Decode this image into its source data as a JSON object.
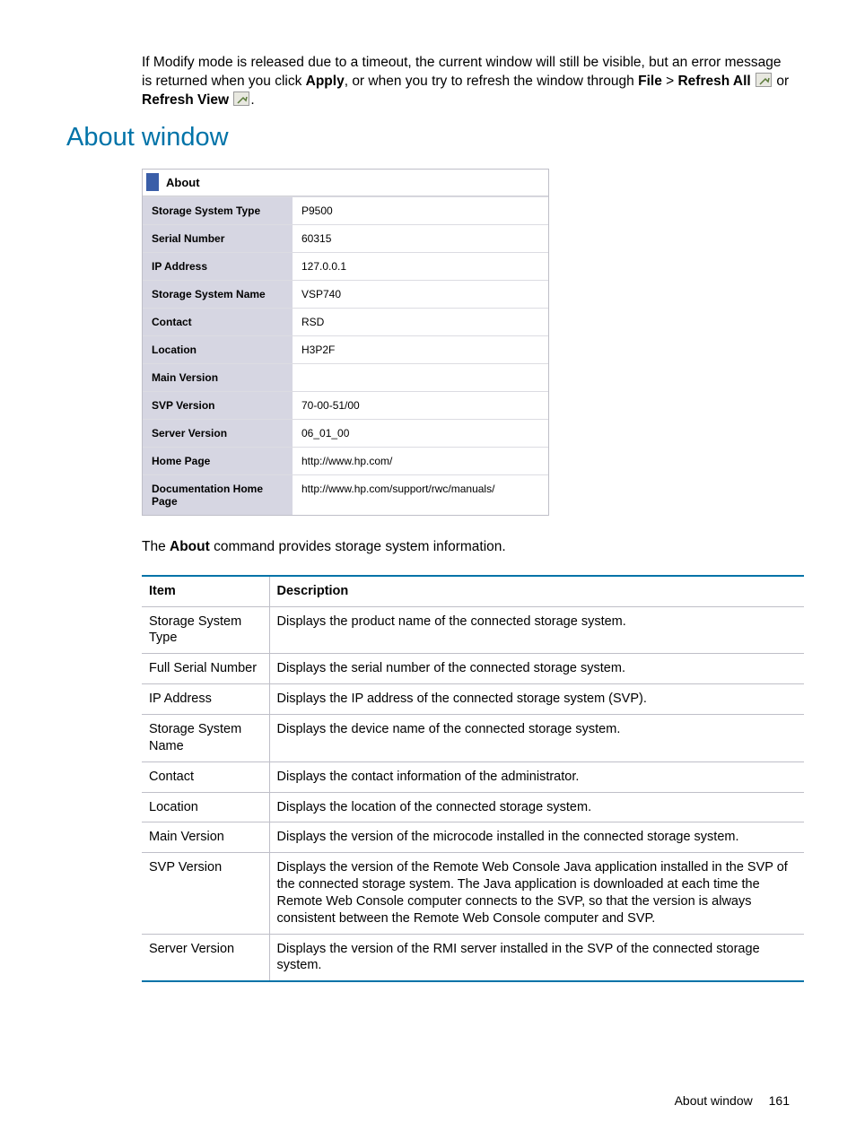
{
  "intro": {
    "part1": "If Modify mode is released due to a timeout, the current window will still be visible, but an error message is returned when you click ",
    "apply": "Apply",
    "part2": ", or when you try to refresh the window through ",
    "file": "File",
    "gt": " > ",
    "refresh_all": "Refresh All",
    "or": " or ",
    "refresh_view": "Refresh View",
    "dot": "."
  },
  "section_heading": "About window",
  "about_panel": {
    "title": "About",
    "rows": [
      {
        "label": "Storage System Type",
        "value": "P9500"
      },
      {
        "label": "Serial Number",
        "value": "60315"
      },
      {
        "label": "IP Address",
        "value": "127.0.0.1"
      },
      {
        "label": "Storage System Name",
        "value": "VSP740"
      },
      {
        "label": "Contact",
        "value": "RSD"
      },
      {
        "label": "Location",
        "value": "H3P2F"
      },
      {
        "label": "Main Version",
        "value": ""
      },
      {
        "label": "SVP Version",
        "value": "70-00-51/00"
      },
      {
        "label": "Server Version",
        "value": "06_01_00"
      },
      {
        "label": "Home Page",
        "value": "http://www.hp.com/"
      },
      {
        "label": "Documentation Home Page",
        "value": "http://www.hp.com/support/rwc/manuals/"
      }
    ]
  },
  "caption": {
    "pre": "The ",
    "about": "About",
    "post": " command provides storage system information."
  },
  "desc_table": {
    "headers": {
      "item": "Item",
      "desc": "Description"
    },
    "rows": [
      {
        "item": "Storage System Type",
        "desc": "Displays the product name of the connected storage system."
      },
      {
        "item": "Full Serial Number",
        "desc": "Displays the serial number of the connected storage system."
      },
      {
        "item": "IP Address",
        "desc": "Displays the IP address of the connected storage system (SVP)."
      },
      {
        "item": "Storage System Name",
        "desc": "Displays the device name of the connected storage system."
      },
      {
        "item": "Contact",
        "desc": "Displays the contact information of the administrator."
      },
      {
        "item": "Location",
        "desc": "Displays the location of the connected storage system."
      },
      {
        "item": "Main Version",
        "desc": "Displays the version of the microcode installed in the connected storage system."
      },
      {
        "item": "SVP Version",
        "desc": "Displays the version of the Remote Web Console Java application installed in the SVP of the connected storage system. The Java application is downloaded at each time the Remote Web Console computer connects to the SVP, so that the version is always consistent between the Remote Web Console computer and SVP."
      },
      {
        "item": "Server Version",
        "desc": "Displays the version of the RMI server installed in the SVP of the connected storage system."
      }
    ]
  },
  "footer": {
    "title": "About window",
    "page": "161"
  }
}
